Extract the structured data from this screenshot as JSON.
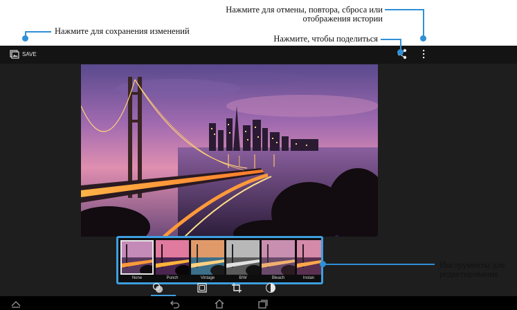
{
  "toolbar": {
    "save_label": "SAVE",
    "gallery_icon": "gallery-icon",
    "share_icon": "share-icon",
    "overflow_icon": "overflow-menu-icon"
  },
  "filters": [
    {
      "label": "None",
      "selected": true
    },
    {
      "label": "Punch",
      "selected": false
    },
    {
      "label": "Vintage",
      "selected": false
    },
    {
      "label": "B/W",
      "selected": false
    },
    {
      "label": "Bleach",
      "selected": false
    },
    {
      "label": "Instan",
      "selected": false
    }
  ],
  "tools": [
    "filters-icon",
    "frame-icon",
    "crop-icon",
    "adjust-icon"
  ],
  "nav": [
    "up-chevron-icon",
    "back-icon",
    "home-icon",
    "recent-apps-icon"
  ],
  "callouts": {
    "save": "Нажмите для сохранения изменений",
    "history": "Нажмите для отмены, повтора, сброса или отображения истории",
    "share": "Нажмите, чтобы поделиться",
    "tools": "Инструменты для редактирования"
  },
  "colors": {
    "accent": "#2f8fd6",
    "background": "#1e1e1e"
  }
}
